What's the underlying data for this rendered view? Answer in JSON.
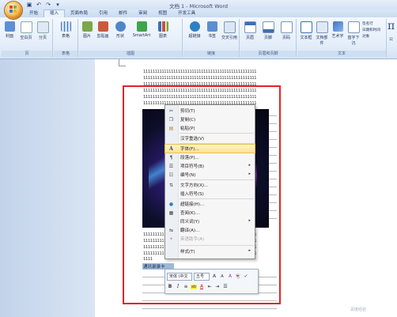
{
  "window": {
    "title": "文档 1 - Microsoft Word"
  },
  "quick_access": [
    "save",
    "undo",
    "redo",
    "customize"
  ],
  "tabs": [
    "开始",
    "插入",
    "页面布局",
    "引用",
    "邮件",
    "审阅",
    "视图",
    "开发工具"
  ],
  "ribbon": {
    "groups": [
      {
        "name": "页",
        "buttons": [
          "封面",
          "空白页",
          "分页"
        ]
      },
      {
        "name": "表格",
        "buttons": [
          "表格"
        ]
      },
      {
        "name": "插图",
        "buttons": [
          "图片",
          "剪贴画",
          "形状",
          "SmartArt",
          "图表"
        ]
      },
      {
        "name": "链接",
        "buttons": [
          "超链接",
          "书签",
          "交叉引用"
        ]
      },
      {
        "name": "页眉和页脚",
        "buttons": [
          "页眉",
          "页脚",
          "页码"
        ]
      },
      {
        "name": "文本",
        "buttons": [
          "文本框",
          "文档部件",
          "艺术字",
          "首字下沉"
        ],
        "small": [
          "签名行",
          "日期和时间",
          "对象"
        ]
      }
    ],
    "overflow_label": "公"
  },
  "document": {
    "ones_line": "1111111111111111111111111111111111111111111111111",
    "short_line": "1111",
    "selected_text": "通讯录录卡"
  },
  "context_menu": {
    "items": [
      {
        "label": "剪切(T)",
        "icon": "scissors-icon"
      },
      {
        "label": "复制(C)",
        "icon": "copy-icon"
      },
      {
        "label": "粘贴(P)",
        "icon": "paste-icon"
      },
      {
        "label": "汉字重选(V)",
        "icon": ""
      },
      {
        "label": "字体(F)...",
        "icon": "font-icon",
        "highlight": true
      },
      {
        "label": "段落(P)...",
        "icon": "paragraph-icon"
      },
      {
        "label": "项目符号(B)",
        "icon": "bullets-icon",
        "submenu": true
      },
      {
        "label": "编号(N)",
        "icon": "numbering-icon",
        "submenu": true
      },
      {
        "label": "文字方向(X)...",
        "icon": "text-direction-icon"
      },
      {
        "label": "插入符号(S)",
        "icon": ""
      },
      {
        "label": "超链接(H)...",
        "icon": "hyperlink-icon"
      },
      {
        "label": "查阅(K)...",
        "icon": "lookup-icon"
      },
      {
        "label": "同义词(Y)",
        "icon": "",
        "submenu": true
      },
      {
        "label": "翻译(A)...",
        "icon": "translate-icon"
      },
      {
        "label": "英语助手(A)",
        "icon": "assistant-icon",
        "disabled": true
      },
      {
        "label": "样式(T)",
        "icon": "",
        "submenu": true
      }
    ]
  },
  "mini_toolbar": {
    "font": "宋体 (中文",
    "size": "五号",
    "row1_tools": [
      "A",
      "A",
      "A",
      "👻",
      "✓"
    ],
    "row2_tools": [
      "B",
      "I",
      "≡",
      "ab",
      "A",
      "⇤",
      "⇥",
      "☰"
    ]
  },
  "watermark": "百度经验"
}
